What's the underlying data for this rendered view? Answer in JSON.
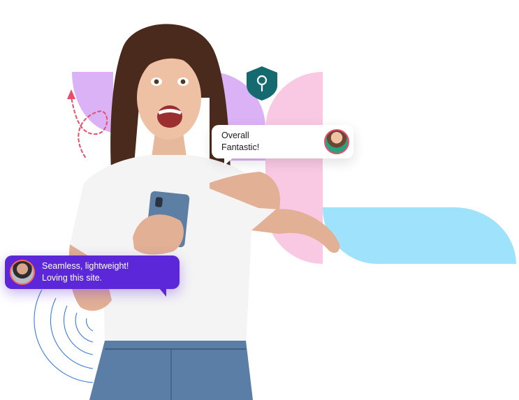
{
  "bubbles": {
    "top_review": {
      "text_line1": "Overall",
      "text_line2": "Fantastic!"
    },
    "bottom_review": {
      "text_line1": "Seamless, lightweight!",
      "text_line2": "Loving this site."
    }
  },
  "icons": {
    "shield": "location-pin-shield-icon",
    "arrow": "dashed-loop-arrow-icon",
    "spiral": "concentric-arcs-decoration"
  },
  "colors": {
    "lavender": "#dcb2f6",
    "pink": "#f9c9e3",
    "sky": "#9fe2fb",
    "teal": "#146a6f",
    "purple_bubble": "#5b27d9",
    "dash_red": "#e94d6a",
    "arc_blue": "#3a7be0"
  }
}
